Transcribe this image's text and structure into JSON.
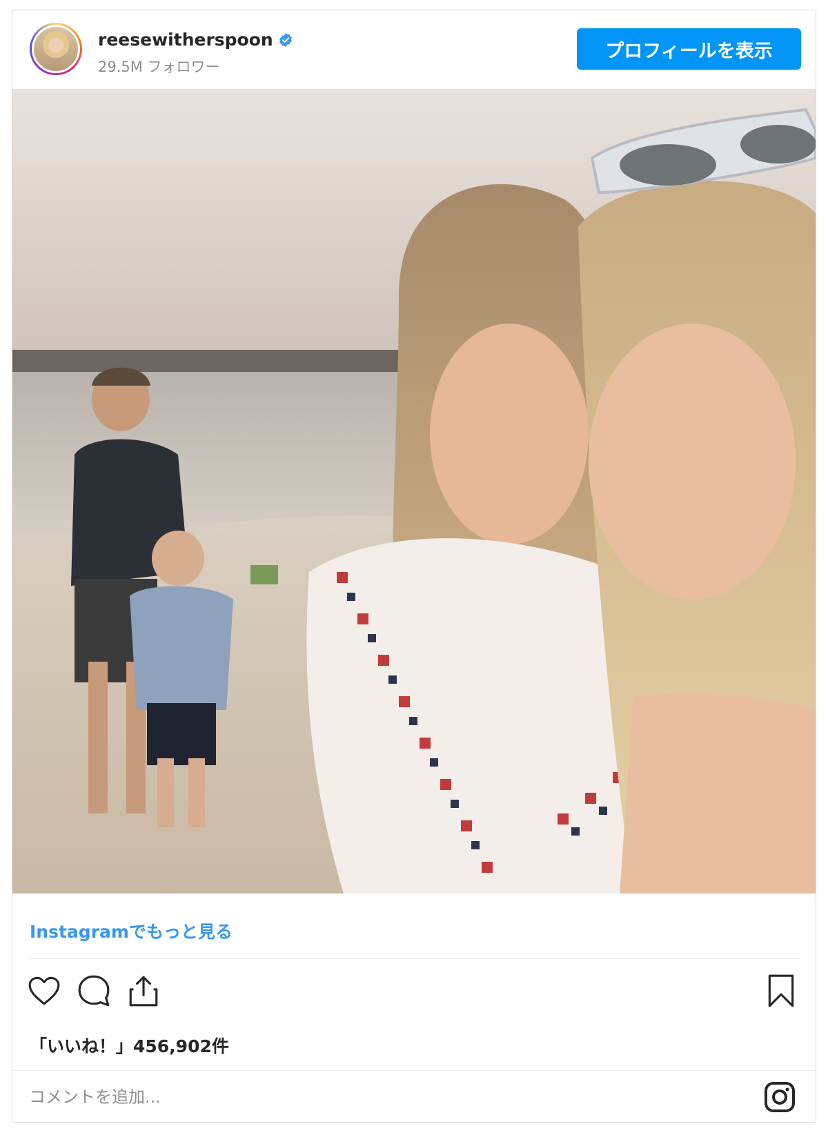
{
  "header": {
    "username": "reesewitherspoon",
    "followers": "29.5M フォロワー",
    "profile_button": "プロフィールを表示"
  },
  "post": {
    "more_link": "Instagramでもっと見る",
    "likes": "「いいね！」456,902件"
  },
  "comment": {
    "placeholder": "コメントを追加..."
  },
  "icons": {
    "verified": "verified-badge-icon",
    "like": "heart-icon",
    "comment": "comment-bubble-icon",
    "share": "share-icon",
    "save": "bookmark-icon",
    "instagram": "instagram-logo-icon"
  },
  "colors": {
    "accent": "#0095f6",
    "link": "#3897f0",
    "text": "#262626",
    "muted": "#8e8e8e"
  }
}
